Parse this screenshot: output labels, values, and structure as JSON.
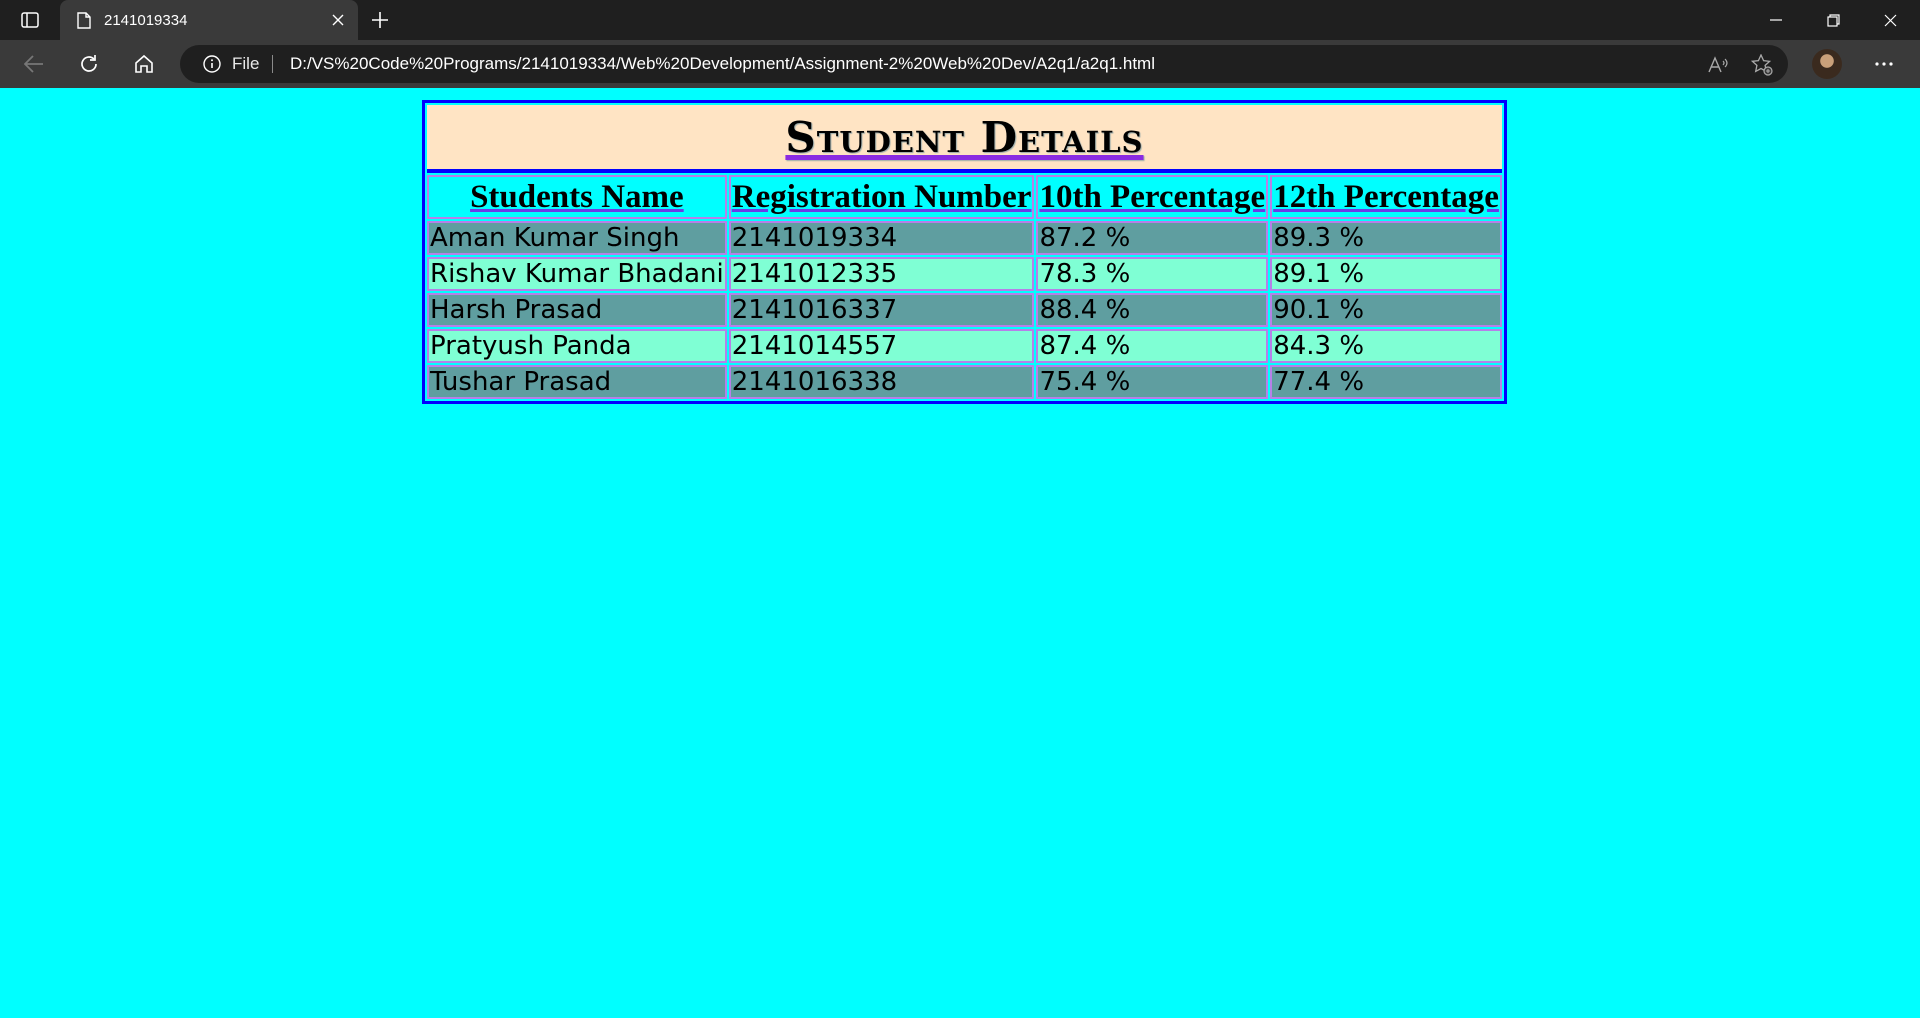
{
  "browser": {
    "tab_title": "2141019334",
    "address_scheme_label": "File",
    "url": "D:/VS%20Code%20Programs/2141019334/Web%20Development/Assignment-2%20Web%20Dev/A2q1/a2q1.html"
  },
  "page": {
    "caption": "Student Details",
    "headers": [
      "Students Name",
      "Registration Number",
      "10th Percentage",
      "12th Percentage"
    ],
    "rows": [
      [
        "Aman Kumar Singh",
        "2141019334",
        "87.2 %",
        "89.3 %"
      ],
      [
        "Rishav Kumar Bhadani",
        "2141012335",
        "78.3 %",
        "89.1 %"
      ],
      [
        "Harsh Prasad",
        "2141016337",
        "88.4 %",
        "90.1 %"
      ],
      [
        "Pratyush Panda",
        "2141014557",
        "87.4 %",
        "84.3 %"
      ],
      [
        "Tushar Prasad",
        "2141016338",
        "75.4 %",
        "77.4 %"
      ]
    ]
  },
  "colors": {
    "page_background": "#00ffff",
    "caption_background": "#ffe4c4",
    "row_dark": "#5f9ea0",
    "row_light": "#7fffd4",
    "table_border": "#0000ff",
    "cell_border": "#b680e8"
  }
}
